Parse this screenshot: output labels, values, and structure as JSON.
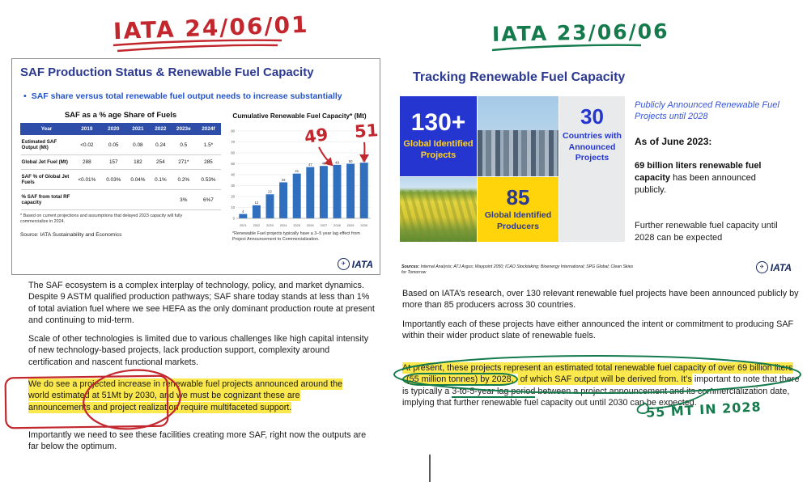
{
  "annotations": {
    "left_title": "IATA 24/06/01",
    "right_title": "IATA 23/06/06",
    "chart_note_49": "49",
    "chart_note_51": "51",
    "green_note": "55 MT IN 2028"
  },
  "icons": {
    "bullet": "•",
    "logo_bird": "✈"
  },
  "colors": {
    "iata_blue": "#2b3990",
    "bullet_blue": "#2653c6",
    "bar_blue": "#2f6fbe",
    "box_blue": "#2436cf",
    "box_yellow": "#ffd40a",
    "highlight_yellow": "#fbe84d",
    "annotation_red": "#c1272d",
    "annotation_green": "#157a4c"
  },
  "left_slide": {
    "title": "SAF Production Status & Renewable Fuel Capacity",
    "bullet": "SAF share versus total renewable fuel output needs to increase substantially",
    "table": {
      "caption": "SAF as a % age Share of Fuels",
      "columns": [
        "Year",
        "2019",
        "2020",
        "2021",
        "2022",
        "2023e",
        "2024f"
      ],
      "rows": [
        {
          "label": "Estimated SAF Output (Mt)",
          "values": [
            "<0.02",
            "0.05",
            "0.08",
            "0.24",
            "0.5",
            "1.5*"
          ]
        },
        {
          "label": "Global Jet Fuel (Mt)",
          "values": [
            "288",
            "157",
            "182",
            "254",
            "271*",
            "285"
          ]
        },
        {
          "label": "SAF % of Global Jet Fuels",
          "values": [
            "<0.01%",
            "0.03%",
            "0.04%",
            "0.1%",
            "0.2%",
            "0.53%"
          ]
        },
        {
          "label": "% SAF from total RF capacity",
          "values": [
            "",
            "",
            "",
            "",
            "3%",
            "6%7"
          ]
        }
      ]
    },
    "table_footnote": "* Based on current projections and assumptions that delayed 2023 capacity will fully commercialize in 2024.",
    "source": "Source: IATA Sustainability and Economics",
    "chart_footnote": "*Renewable Fuel projects typically have a 3–5 year lag effect from Project Announcement to Commercialization.",
    "logo_text": "IATA"
  },
  "chart_data": {
    "type": "bar",
    "title": "Cumulative Renewable Fuel Capacity* (Mt)",
    "categories": [
      "2021",
      "2022",
      "2023",
      "2024",
      "2025",
      "2026",
      "2027",
      "2028",
      "2029",
      "2030"
    ],
    "values": [
      4,
      12,
      22,
      33,
      41,
      47,
      48,
      49,
      50,
      51
    ],
    "xlabel": "",
    "ylabel": "",
    "ylim": [
      0,
      80
    ],
    "ytick_step": 10,
    "grid": true,
    "legend": false,
    "bar_color": "#2f6fbe"
  },
  "left_text": {
    "p1": "The SAF ecosystem is a complex interplay of technology, policy, and market dynamics. Despite 9 ASTM qualified production pathways; SAF share today stands at less than 1% of total aviation fuel where we see HEFA as the only dominant production route at present and continuing to mid-term.",
    "p2": "Scale of other technologies is limited due to various challenges like high capital intensity of new technology-based projects, lack production support, complexity around certification and nascent functional markets.",
    "p3_highlight": "We do see a projected increase in renewable fuel projects announced around the world estimated at 51Mt by 2030, and we must be cognizant these are announcements and project realization require multifaceted support.",
    "p4": "Importantly we need to see these facilities creating more SAF, right now the outputs are far below the optimum."
  },
  "right_slide": {
    "title": "Tracking Renewable Fuel Capacity",
    "stat_projects": {
      "value": "130+",
      "label": "Global Identified Projects"
    },
    "stat_countries": {
      "value": "30",
      "label": "Countries with Announced Projects"
    },
    "stat_producers": {
      "value": "85",
      "label": "Global Identified Producers"
    },
    "kicker": "Publicly Announced Renewable Fuel Projects until 2028",
    "as_of": "As of June 2023:",
    "fact_bold": "69 billion liters renewable fuel capacity",
    "fact_rest": " has been announced publicly.",
    "more": "Further renewable fuel capacity until 2028 can be expected",
    "sources_label": "Sources:",
    "sources": " Internal Analysis; ATJ Argus; Waypoint 2050; ICAO Stocktaking; Bioenergy International; SPG Global; Clean Skies for Tomorrow",
    "logo_text": "IATA"
  },
  "right_text": {
    "p1": "Based on IATA’s research, over 130 relevant renewable fuel projects have been announced publicly by more than 85 producers across 30 countries.",
    "p2": "Importantly each of these projects have either announced the intent or commitment to producing SAF within their wider product slate of renewable fuels.",
    "p3_h1": "At present, these projects represent an estimated total renewable fuel capacity of over 69 billion liters ",
    "p3_circled": "(55 million tonnes) by 2028,",
    "p3_h2": " of which SAF output will be derived from. It’s",
    "p3_plain1": " important to note that there is typically a ",
    "p3_underlined": "3-to-5-year lag period",
    "p3_plain2": " between a project announcement and its commercialization date, implying that further renewable fuel capacity out until 2030 can be expected."
  }
}
